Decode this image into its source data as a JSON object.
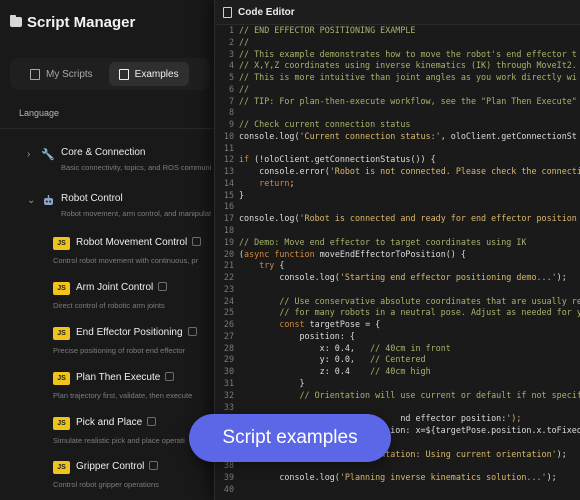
{
  "app": {
    "title": "Script Manager"
  },
  "tabs": [
    {
      "label": "My Scripts",
      "active": false
    },
    {
      "label": "Examples",
      "active": true
    }
  ],
  "language_label": "Language",
  "categories": [
    {
      "name": "Core & Connection",
      "description": "Basic connectivity, topics, and ROS communi",
      "expanded": false,
      "icon": "wrench-icon"
    },
    {
      "name": "Robot Control",
      "description": "Robot movement, arm control, and manipulati",
      "expanded": true,
      "icon": "robot-icon"
    }
  ],
  "scripts": [
    {
      "name": "Robot Movement Control",
      "description": "Control robot movement with continuous, pr"
    },
    {
      "name": "Arm Joint Control",
      "description": "Direct control of robotic arm joints"
    },
    {
      "name": "End Effector Positioning",
      "description": "Precise positioning of robot end effector"
    },
    {
      "name": "Plan Then Execute",
      "description": "Plan trajectory first, validate, then execute"
    },
    {
      "name": "Pick and Place",
      "description": "Simulate realistic pick and place operati"
    },
    {
      "name": "Gripper Control",
      "description": "Control robot gripper operations"
    }
  ],
  "editor": {
    "title": "Code Editor",
    "lines": [
      {
        "n": "1",
        "text": "// END EFFECTOR POSITIONING EXAMPLE",
        "kind": "cmt"
      },
      {
        "n": "2",
        "text": "//",
        "kind": "cmt"
      },
      {
        "n": "3",
        "text": "// This example demonstrates how to move the robot's end effector t",
        "kind": "cmt"
      },
      {
        "n": "4",
        "text": "// X,Y,Z coordinates using inverse kinematics (IK) through MoveIt2.",
        "kind": "cmt"
      },
      {
        "n": "5",
        "text": "// This is more intuitive than joint angles as you work directly wi",
        "kind": "cmt"
      },
      {
        "n": "6",
        "text": "//",
        "kind": "cmt"
      },
      {
        "n": "7",
        "text": "// TIP: For plan-then-execute workflow, see the \"Plan Then Execute\"",
        "kind": "cmt"
      },
      {
        "n": "8",
        "text": "",
        "kind": "code"
      },
      {
        "n": "9",
        "text": "// Check current connection status",
        "kind": "cmt"
      },
      {
        "n": "10",
        "text": "console.log('Current connection status:', oloClient.getConnectionSt",
        "kind": "code"
      },
      {
        "n": "11",
        "text": "",
        "kind": "code"
      },
      {
        "n": "12",
        "text": "if (!oloClient.getConnectionStatus()) {",
        "kind": "code"
      },
      {
        "n": "13",
        "text": "    console.error('Robot is not connected. Please check the connecti",
        "kind": "code"
      },
      {
        "n": "14",
        "text": "    return;",
        "kind": "code"
      },
      {
        "n": "15",
        "text": "}",
        "kind": "code"
      },
      {
        "n": "16",
        "text": "",
        "kind": "code"
      },
      {
        "n": "17",
        "text": "console.log('Robot is connected and ready for end effector position",
        "kind": "code"
      },
      {
        "n": "18",
        "text": "",
        "kind": "code"
      },
      {
        "n": "19",
        "text": "// Demo: Move end effector to target coordinates using IK",
        "kind": "cmt"
      },
      {
        "n": "20",
        "text": "(async function moveEndEffectorToPosition() {",
        "kind": "code"
      },
      {
        "n": "21",
        "text": "    try {",
        "kind": "code"
      },
      {
        "n": "22",
        "text": "        console.log('Starting end effector positioning demo...');",
        "kind": "code"
      },
      {
        "n": "23",
        "text": "",
        "kind": "code"
      },
      {
        "n": "24",
        "text": "        // Use conservative absolute coordinates that are usually re",
        "kind": "cmt"
      },
      {
        "n": "25",
        "text": "        // for many robots in a neutral pose. Adjust as needed for y",
        "kind": "cmt"
      },
      {
        "n": "26",
        "text": "        const targetPose = {",
        "kind": "code"
      },
      {
        "n": "27",
        "text": "            position: {",
        "kind": "code"
      },
      {
        "n": "28",
        "text": "                x: 0.4,   // 40cm in front",
        "kind": "code"
      },
      {
        "n": "29",
        "text": "                y: 0.0,   // Centered",
        "kind": "code"
      },
      {
        "n": "30",
        "text": "                z: 0.4    // 40cm high",
        "kind": "code"
      },
      {
        "n": "31",
        "text": "            }",
        "kind": "code"
      },
      {
        "n": "32",
        "text": "            // Orientation will use current or default if not specif",
        "kind": "cmt"
      },
      {
        "n": "33",
        "text": "",
        "kind": "code"
      },
      {
        "n": "34",
        "text": "                                nd effector position:');",
        "kind": "code"
      },
      {
        "n": "35",
        "text": "                              ion: x=${targetPose.position.x.toFixed(",
        "kind": "code"
      },
      {
        "n": "36",
        "text": "",
        "kind": "code"
      },
      {
        "n": "37",
        "text": "        console.log('   Orientation: Using current orientation');",
        "kind": "code"
      },
      {
        "n": "38",
        "text": "",
        "kind": "code"
      },
      {
        "n": "39",
        "text": "        console.log('Planning inverse kinematics solution...');",
        "kind": "code"
      },
      {
        "n": "40",
        "text": "",
        "kind": "code"
      }
    ]
  },
  "overlay": {
    "label": "Script examples",
    "color": "#5b67e6"
  }
}
